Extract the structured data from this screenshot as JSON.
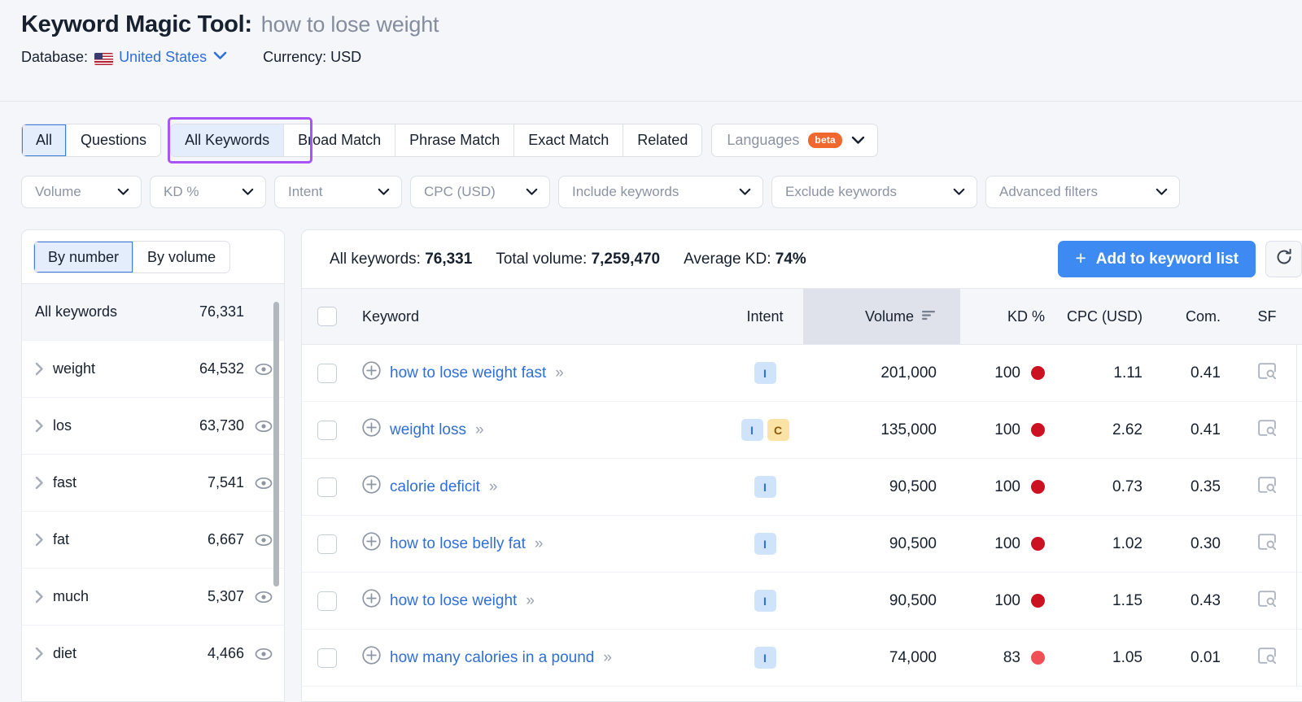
{
  "header": {
    "title_prefix": "Keyword Magic Tool:",
    "keyword": "how to lose weight",
    "database_label": "Database:",
    "database_value": "United States",
    "currency": "Currency: USD",
    "flag_icon": "us-flag-icon"
  },
  "tabs": {
    "group_a": [
      {
        "label": "All",
        "active": true
      },
      {
        "label": "Questions",
        "active": false
      }
    ],
    "group_b": [
      {
        "label": "All Keywords",
        "active": true,
        "highlighted": true
      },
      {
        "label": "Broad Match",
        "active": false
      },
      {
        "label": "Phrase Match",
        "active": false
      },
      {
        "label": "Exact Match",
        "active": false
      },
      {
        "label": "Related",
        "active": false
      }
    ],
    "languages": {
      "label": "Languages",
      "badge": "beta"
    }
  },
  "filters": [
    {
      "label": "Volume"
    },
    {
      "label": "KD %"
    },
    {
      "label": "Intent"
    },
    {
      "label": "CPC (USD)"
    },
    {
      "label": "Include keywords"
    },
    {
      "label": "Exclude keywords"
    },
    {
      "label": "Advanced filters"
    }
  ],
  "sidebar": {
    "toggle": [
      {
        "label": "By number",
        "active": true
      },
      {
        "label": "By volume",
        "active": false
      }
    ],
    "all_row": {
      "label": "All keywords",
      "count": "76,331"
    },
    "items": [
      {
        "label": "weight",
        "count": "64,532"
      },
      {
        "label": "los",
        "count": "63,730"
      },
      {
        "label": "fast",
        "count": "7,541"
      },
      {
        "label": "fat",
        "count": "6,667"
      },
      {
        "label": "much",
        "count": "5,307"
      },
      {
        "label": "diet",
        "count": "4,466"
      }
    ]
  },
  "summary": {
    "all_keywords_label": "All keywords:",
    "all_keywords_value": "76,331",
    "total_volume_label": "Total volume:",
    "total_volume_value": "7,259,470",
    "average_kd_label": "Average KD:",
    "average_kd_value": "74%",
    "add_button": "Add to keyword list",
    "add_button_plus": "+",
    "refresh_icon": "refresh-icon"
  },
  "table": {
    "columns": {
      "keyword": "Keyword",
      "intent": "Intent",
      "volume": "Volume",
      "kd": "KD %",
      "cpc": "CPC (USD)",
      "com": "Com.",
      "sf": "SF"
    },
    "sorted_by": "Volume",
    "rows": [
      {
        "keyword": "how to lose weight fast",
        "intents": [
          "I"
        ],
        "volume": "201,000",
        "kd": "100",
        "kd_color": "#cc1122",
        "cpc": "1.11",
        "com": "0.41",
        "sf_icon": "serp-preview-icon"
      },
      {
        "keyword": "weight loss",
        "intents": [
          "I",
          "C"
        ],
        "volume": "135,000",
        "kd": "100",
        "kd_color": "#cc1122",
        "cpc": "2.62",
        "com": "0.41",
        "sf_icon": "serp-preview-icon"
      },
      {
        "keyword": "calorie deficit",
        "intents": [
          "I"
        ],
        "volume": "90,500",
        "kd": "100",
        "kd_color": "#cc1122",
        "cpc": "0.73",
        "com": "0.35",
        "sf_icon": "serp-preview-icon"
      },
      {
        "keyword": "how to lose belly fat",
        "intents": [
          "I"
        ],
        "volume": "90,500",
        "kd": "100",
        "kd_color": "#cc1122",
        "cpc": "1.02",
        "com": "0.30",
        "sf_icon": "serp-preview-icon"
      },
      {
        "keyword": "how to lose weight",
        "intents": [
          "I"
        ],
        "volume": "90,500",
        "kd": "100",
        "kd_color": "#cc1122",
        "cpc": "1.15",
        "com": "0.43",
        "sf_icon": "serp-preview-icon"
      },
      {
        "keyword": "how many calories in a pound",
        "intents": [
          "I"
        ],
        "volume": "74,000",
        "kd": "83",
        "kd_color": "#f05055",
        "cpc": "1.05",
        "com": "0.01",
        "sf_icon": "serp-preview-icon"
      }
    ]
  },
  "colors": {
    "accent_blue": "#3d8bf2",
    "link_blue": "#2f6fd6",
    "highlight_purple": "#a855f7",
    "beta_orange": "#f0682e"
  }
}
